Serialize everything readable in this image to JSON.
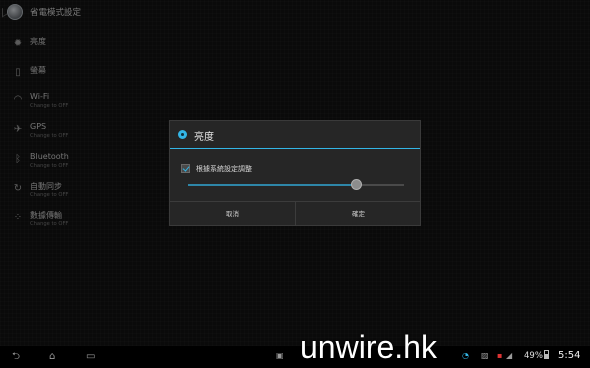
{
  "actionbar": {
    "title": "省電模式設定",
    "icon": "power-saver-icon"
  },
  "settings": [
    {
      "label": "亮度",
      "sub": "",
      "icon": "brightness-icon"
    },
    {
      "label": "螢幕",
      "sub": "",
      "icon": "screen-icon"
    },
    {
      "label": "Wi-Fi",
      "sub": "Change to OFF",
      "icon": "wifi-icon"
    },
    {
      "label": "GPS",
      "sub": "Change to OFF",
      "icon": "gps-icon"
    },
    {
      "label": "Bluetooth",
      "sub": "Change to OFF",
      "icon": "bluetooth-icon"
    },
    {
      "label": "自動同步",
      "sub": "Change to OFF",
      "icon": "sync-icon"
    },
    {
      "label": "數據傳輸",
      "sub": "Change to OFF",
      "icon": "data-transfer-icon"
    }
  ],
  "dialog": {
    "title": "亮度",
    "checkbox_label": "根據系統設定調整",
    "checkbox_checked": true,
    "brightness_level": 0.78,
    "cancel_label": "取消",
    "ok_label": "確定",
    "accent_color": "#33b5e5"
  },
  "statusbar": {
    "watermark": "unwire.hk",
    "battery": "49%",
    "time": "5:54"
  }
}
